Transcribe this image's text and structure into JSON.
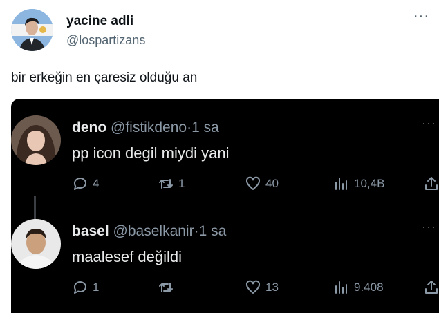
{
  "tweet": {
    "author_name": "yacine adli",
    "author_handle": "@lospartizans",
    "text": "bir erkeğin en çaresiz olduğu an",
    "more_icon": "more-horizontal-icon"
  },
  "screenshot": {
    "replies": [
      {
        "name": "deno",
        "handle": "@fistikdeno",
        "separator": "·",
        "time": "1 sa",
        "text": "pp icon degil miydi yani",
        "reply_count": "4",
        "retweet_count": "1",
        "like_count": "40",
        "view_count": "10,4B"
      },
      {
        "name": "basel",
        "handle": "@baselkanir",
        "separator": "·",
        "time": "1 sa",
        "text": "maalesef değildi",
        "reply_count": "1",
        "retweet_count": "",
        "like_count": "13",
        "view_count": "9.408"
      }
    ]
  },
  "colors": {
    "dark_bg": "#000000",
    "dark_text": "#e7e9ea",
    "dark_muted": "#8b98a5",
    "light_text": "#0f1419",
    "light_muted": "#536471"
  }
}
